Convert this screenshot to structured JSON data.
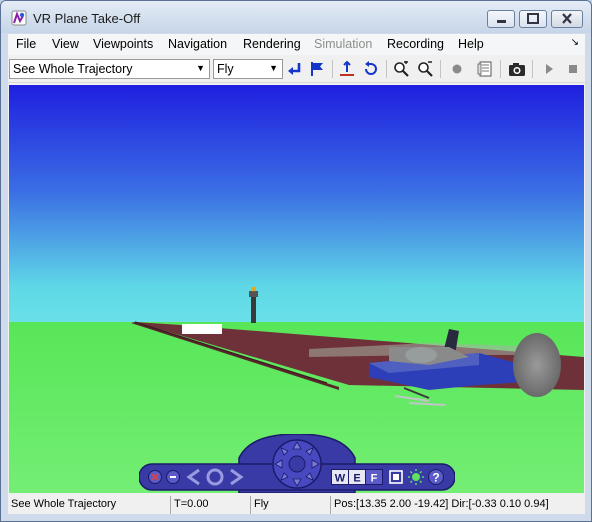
{
  "window": {
    "title": "VR Plane Take-Off"
  },
  "menu": {
    "file": "File",
    "view": "View",
    "viewpoints": "Viewpoints",
    "navigation": "Navigation",
    "rendering": "Rendering",
    "simulation": "Simulation",
    "recording": "Recording",
    "help": "Help"
  },
  "toolbar": {
    "viewpoint_select": "See Whole Trajectory",
    "navigation_mode": "Fly"
  },
  "status": {
    "viewpoint": "See Whole Trajectory",
    "time": "T=0.00",
    "mode": "Fly",
    "position": "Pos:[13.35 2.00 -19.42] Dir:[-0.33 0.10 0.94]"
  },
  "nav_panel": {
    "walk": "W",
    "examine": "E",
    "fly": "F"
  },
  "colors": {
    "sky_top": "#1f1fe0",
    "sky_horizon": "#5fd8e6",
    "ground": "#66ec66",
    "runway": "#6e3139",
    "plane_body": "#2c3fb8",
    "nav_panel": "#3a3aa6"
  }
}
